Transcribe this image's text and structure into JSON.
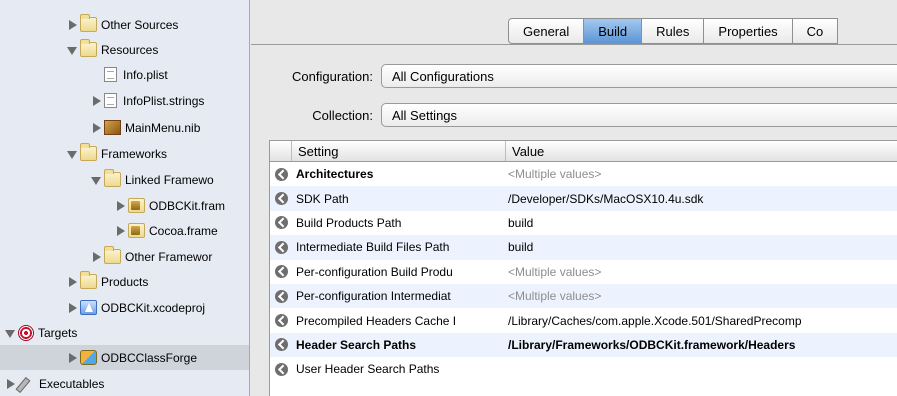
{
  "sidebar": {
    "items": [
      {
        "label": "Other Sources",
        "icon": "folder-icon",
        "depth": 1,
        "disclosure": "closed"
      },
      {
        "label": "Resources",
        "icon": "folder-icon",
        "depth": 1,
        "disclosure": "open"
      },
      {
        "label": "Info.plist",
        "icon": "plist-file-icon",
        "depth": 2,
        "disclosure": "none"
      },
      {
        "label": "InfoPlist.strings",
        "icon": "strings-file-icon",
        "depth": 2,
        "disclosure": "closed"
      },
      {
        "label": "MainMenu.nib",
        "icon": "nib-file-icon",
        "depth": 2,
        "disclosure": "closed"
      },
      {
        "label": "Frameworks",
        "icon": "folder-icon",
        "depth": 1,
        "disclosure": "open"
      },
      {
        "label": "Linked Framewo",
        "icon": "folder-icon",
        "depth": 2,
        "disclosure": "open"
      },
      {
        "label": "ODBCKit.fram",
        "icon": "framework-icon",
        "depth": 3,
        "disclosure": "closed"
      },
      {
        "label": "Cocoa.frame",
        "icon": "framework-icon",
        "depth": 3,
        "disclosure": "closed"
      },
      {
        "label": "Other Framewor",
        "icon": "folder-icon",
        "depth": 2,
        "disclosure": "closed"
      },
      {
        "label": "Products",
        "icon": "folder-icon",
        "depth": 1,
        "disclosure": "closed"
      },
      {
        "label": "ODBCKit.xcodeproj",
        "icon": "xcodeproj-icon",
        "depth": 1,
        "disclosure": "closed"
      },
      {
        "label": "Targets",
        "icon": "target-icon",
        "depth": 0,
        "disclosure": "open"
      },
      {
        "label": "ODBCClassForge",
        "icon": "application-icon",
        "depth": 1,
        "disclosure": "closed",
        "selected": true
      },
      {
        "label": "Executables",
        "icon": "executable-icon",
        "depth": 0,
        "disclosure": "closed"
      }
    ]
  },
  "tabs": [
    {
      "label": "General"
    },
    {
      "label": "Build",
      "active": true
    },
    {
      "label": "Rules"
    },
    {
      "label": "Properties"
    },
    {
      "label": "Co"
    }
  ],
  "configuration": {
    "label": "Configuration:",
    "value": "All Configurations"
  },
  "collection": {
    "label": "Collection:",
    "value": "All Settings"
  },
  "table": {
    "headers": {
      "setting": "Setting",
      "value": "Value"
    },
    "rows": [
      {
        "setting": "Architectures",
        "value": "<Multiple values>",
        "bold": true,
        "grey": true
      },
      {
        "setting": "SDK Path",
        "value": "/Developer/SDKs/MacOSX10.4u.sdk"
      },
      {
        "setting": "Build Products Path",
        "value": "build"
      },
      {
        "setting": "Intermediate Build Files Path",
        "value": "build"
      },
      {
        "setting": "Per-configuration Build Produ",
        "value": "<Multiple values>",
        "grey": true
      },
      {
        "setting": "Per-configuration Intermediat",
        "value": "<Multiple values>",
        "grey": true
      },
      {
        "setting": "Precompiled Headers Cache I",
        "value": "/Library/Caches/com.apple.Xcode.501/SharedPrecomp"
      },
      {
        "setting": "Header Search Paths",
        "value": "/Library/Frameworks/ODBCKit.framework/Headers",
        "bold": true,
        "boldValue": true
      },
      {
        "setting": "User Header Search Paths",
        "value": ""
      }
    ]
  }
}
